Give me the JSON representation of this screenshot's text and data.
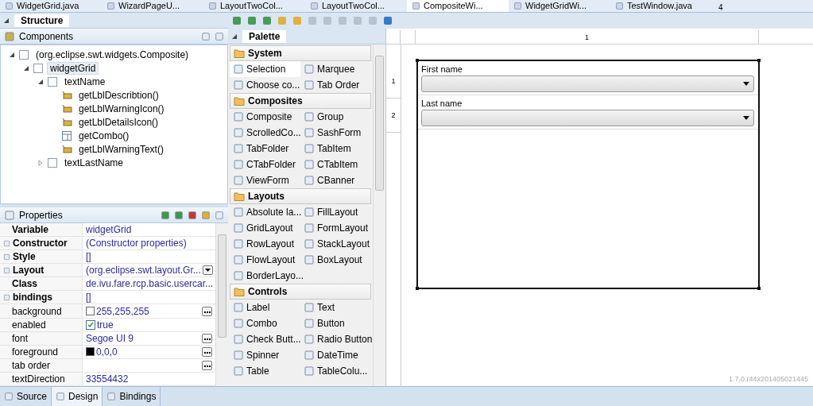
{
  "editor_tabs": [
    {
      "label": "WidgetGrid.java",
      "selected": false
    },
    {
      "label": "WizardPageU...",
      "selected": false
    },
    {
      "label": "LayoutTwoCol...",
      "selected": false
    },
    {
      "label": "LayoutTwoCol...",
      "selected": false
    },
    {
      "label": "CompositeWi...",
      "selected": true
    },
    {
      "label": "WidgetGridWi...",
      "selected": false
    },
    {
      "label": "TestWindow.java",
      "selected": false
    }
  ],
  "editor_tabs_overflow": "4",
  "structure": {
    "title": "Structure",
    "components_title": "Components",
    "tree": [
      {
        "label": "(org.eclipse.swt.widgets.Composite)",
        "kind": "composite",
        "selected": false,
        "expanded": true,
        "children": [
          {
            "label": "widgetGrid",
            "kind": "composite",
            "selected": true,
            "expanded": true,
            "children": [
              {
                "label": "textName",
                "kind": "composite",
                "selected": false,
                "expanded": true,
                "children": [
                  {
                    "label": "getLblDescribtion()",
                    "kind": "label",
                    "selected": false
                  },
                  {
                    "label": "getLblWarningIcon()",
                    "kind": "label",
                    "selected": false
                  },
                  {
                    "label": "getLblDetailsIcon()",
                    "kind": "label",
                    "selected": false
                  },
                  {
                    "label": "getCombo()",
                    "kind": "combo",
                    "selected": false
                  },
                  {
                    "label": "getLblWarningText()",
                    "kind": "label",
                    "selected": false
                  }
                ]
              },
              {
                "label": "textLastName",
                "kind": "composite",
                "selected": false,
                "expanded": false
              }
            ]
          }
        ]
      }
    ]
  },
  "properties": {
    "title": "Properties",
    "rows": [
      {
        "name": "Variable",
        "bold": true,
        "expandable": false,
        "kind": "text",
        "value": "widgetGrid"
      },
      {
        "name": "Constructor",
        "bold": true,
        "expandable": true,
        "kind": "text",
        "value": "(Constructor properties)"
      },
      {
        "name": "Style",
        "bold": true,
        "expandable": true,
        "kind": "text",
        "value": "[]"
      },
      {
        "name": "Layout",
        "bold": true,
        "expandable": true,
        "kind": "dropdown",
        "value": "(org.eclipse.swt.layout.Gr..."
      },
      {
        "name": "Class",
        "bold": true,
        "expandable": false,
        "kind": "text",
        "value": "de.ivu.fare.rcp.basic.usercar..."
      },
      {
        "name": "bindings",
        "bold": true,
        "expandable": true,
        "kind": "text",
        "value": "[]"
      },
      {
        "name": "background",
        "bold": false,
        "expandable": false,
        "kind": "color",
        "color": "#ffffff",
        "value": "255,255,255"
      },
      {
        "name": "enabled",
        "bold": false,
        "expandable": false,
        "kind": "check",
        "checked": true,
        "value": "true"
      },
      {
        "name": "font",
        "bold": false,
        "expandable": false,
        "kind": "dialog",
        "value": "Segoe UI 9"
      },
      {
        "name": "foreground",
        "bold": false,
        "expandable": false,
        "kind": "color",
        "color": "#000000",
        "value": "0,0,0"
      },
      {
        "name": "tab order",
        "bold": false,
        "expandable": false,
        "kind": "dialog",
        "value": ""
      },
      {
        "name": "textDirection",
        "bold": false,
        "expandable": false,
        "kind": "text",
        "value": "33554432"
      }
    ]
  },
  "palette": {
    "title": "Palette",
    "groups": [
      {
        "name": "System",
        "items": [
          {
            "label": "Selection",
            "selected": true
          },
          {
            "label": "Marquee",
            "selected": false
          },
          {
            "label": "Choose co...",
            "selected": false
          },
          {
            "label": "Tab Order",
            "selected": false
          }
        ]
      },
      {
        "name": "Composites",
        "items": [
          {
            "label": "Composite",
            "selected": false
          },
          {
            "label": "Group",
            "selected": false
          },
          {
            "label": "ScrolledCo...",
            "selected": false
          },
          {
            "label": "SashForm",
            "selected": false
          },
          {
            "label": "TabFolder",
            "selected": false
          },
          {
            "label": "TabItem",
            "selected": false
          },
          {
            "label": "CTabFolder",
            "selected": false
          },
          {
            "label": "CTabItem",
            "selected": false
          },
          {
            "label": "ViewForm",
            "selected": false
          },
          {
            "label": "CBanner",
            "selected": false
          }
        ]
      },
      {
        "name": "Layouts",
        "items": [
          {
            "label": "Absolute la...",
            "selected": false
          },
          {
            "label": "FillLayout",
            "selected": false
          },
          {
            "label": "GridLayout",
            "selected": false
          },
          {
            "label": "FormLayout",
            "selected": false
          },
          {
            "label": "RowLayout",
            "selected": false
          },
          {
            "label": "StackLayout",
            "selected": false
          },
          {
            "label": "FlowLayout",
            "selected": false
          },
          {
            "label": "BoxLayout",
            "selected": false
          },
          {
            "label": "BorderLayo...",
            "selected": false
          }
        ]
      },
      {
        "name": "Controls",
        "items": [
          {
            "label": "Label",
            "selected": false
          },
          {
            "label": "Text",
            "selected": false
          },
          {
            "label": "Combo",
            "selected": false
          },
          {
            "label": "Button",
            "selected": false
          },
          {
            "label": "Check Butt...",
            "selected": false
          },
          {
            "label": "Radio Button",
            "selected": false
          },
          {
            "label": "Spinner",
            "selected": false
          },
          {
            "label": "DateTime",
            "selected": false
          },
          {
            "label": "Table",
            "selected": false
          },
          {
            "label": "TableColu...",
            "selected": false
          }
        ]
      }
    ]
  },
  "canvas": {
    "column_header": "1",
    "row_headers": [
      "1",
      "2"
    ],
    "fields": [
      {
        "label": "First name"
      },
      {
        "label": "Last name"
      }
    ],
    "version": "1.7.0.r44x201405021445"
  },
  "bottom_tabs": [
    {
      "label": "Source",
      "selected": false
    },
    {
      "label": "Design",
      "selected": true
    },
    {
      "label": "Bindings",
      "selected": false
    }
  ]
}
